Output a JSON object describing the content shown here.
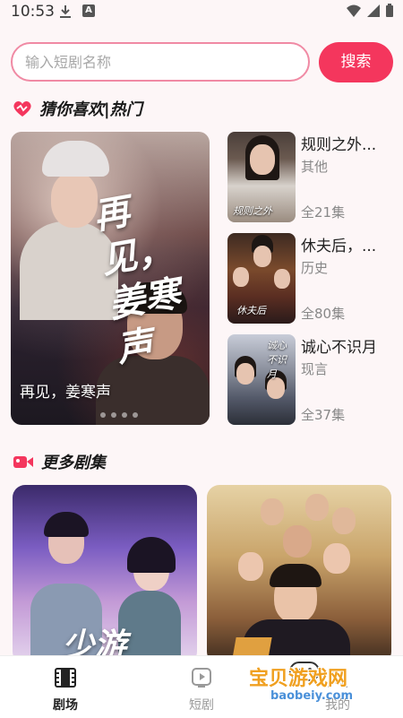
{
  "status_bar": {
    "time": "10:53"
  },
  "search": {
    "placeholder": "输入短剧名称",
    "button_label": "搜索"
  },
  "section_guess": {
    "title": "猜你喜欢|热门"
  },
  "featured": {
    "title_art": "再见，姜寒声",
    "caption": "再见，姜寒声"
  },
  "side_list": [
    {
      "title": "规则之外...",
      "genre": "其他",
      "episodes": "全21集",
      "thumb_text": "规则之外"
    },
    {
      "title": "休夫后，...",
      "genre": "历史",
      "episodes": "全80集",
      "thumb_text": "休夫后"
    },
    {
      "title": "诚心不识月",
      "genre": "现言",
      "episodes": "全37集",
      "thumb_text": "诚心不识月"
    }
  ],
  "section_more": {
    "title": "更多剧集"
  },
  "more_cards": [
    {
      "poster_text": "少游"
    },
    {
      "poster_text": ""
    }
  ],
  "bottom_nav": [
    {
      "label": "剧场",
      "active": true
    },
    {
      "label": "短剧",
      "active": false
    },
    {
      "label": "我的",
      "active": false
    }
  ],
  "watermark": {
    "title": "宝贝游戏网",
    "url": "baobeiy.com"
  },
  "colors": {
    "accent": "#f4365d",
    "border": "#f08aa4",
    "bg": "#fdf6f7"
  }
}
